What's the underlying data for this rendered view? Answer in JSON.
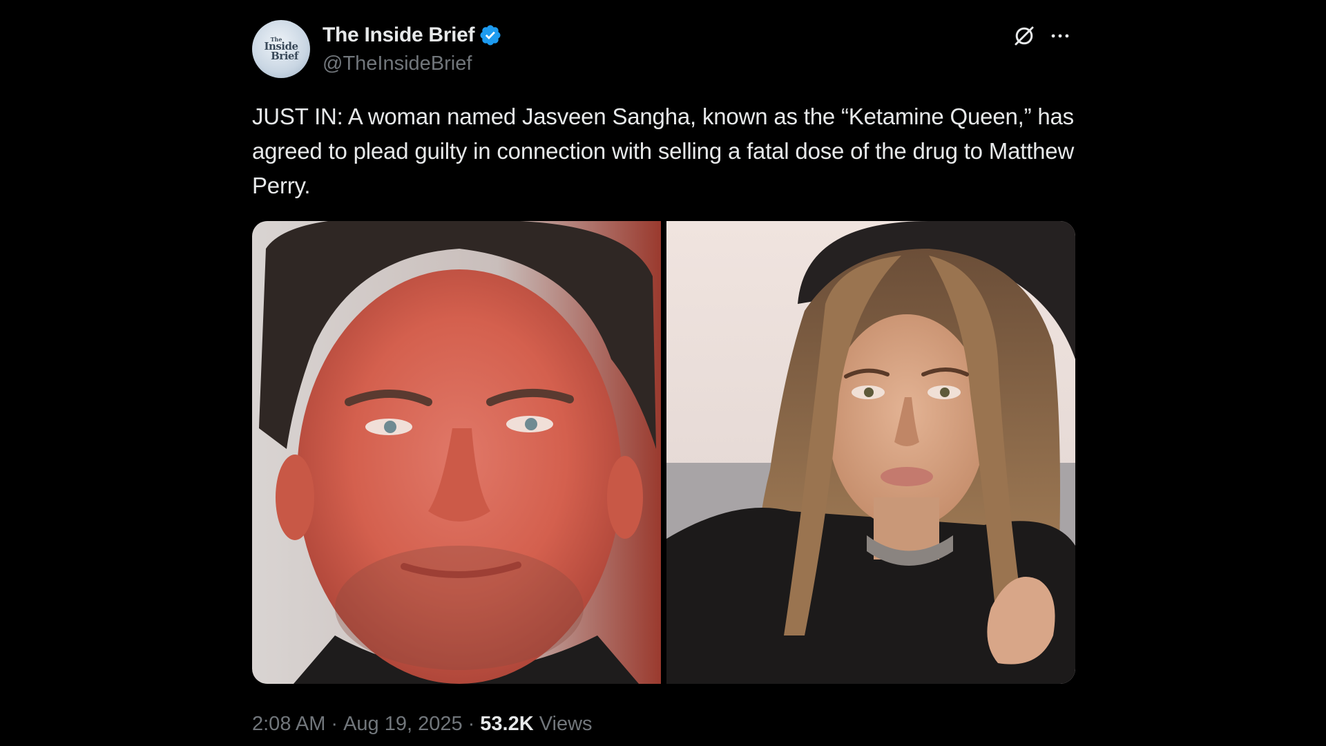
{
  "author": {
    "display_name": "The Inside Brief",
    "handle": "@TheInsideBrief",
    "avatar_text": [
      "The",
      "Inside",
      "Brief"
    ],
    "verified": true,
    "verified_color": "#1d9bf0"
  },
  "header_actions": {
    "grok_icon": "grok-icon",
    "more_icon": "more-icon"
  },
  "tweet": {
    "text": "JUST IN: A woman named Jasveen Sangha, known as the “Ketamine Queen,” has agreed to plead guilty in connection with selling a fatal dose of the drug to Matthew Perry."
  },
  "media": {
    "left_photo": "photo of Matthew Perry",
    "right_photo": "photo of Jasveen Sangha"
  },
  "meta": {
    "time": "2:08 AM",
    "separator": "·",
    "date": "Aug 19, 2025",
    "views_count": "53.2K",
    "views_label": "Views"
  },
  "colors": {
    "background": "#000000",
    "text_primary": "#e7e9ea",
    "text_secondary": "#71767b",
    "accent": "#1d9bf0"
  }
}
